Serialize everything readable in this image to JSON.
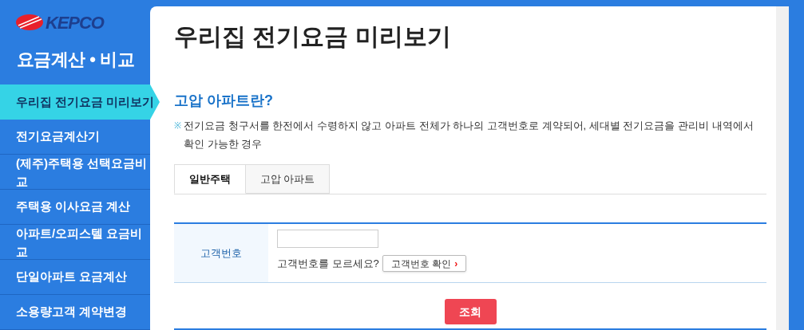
{
  "logo": {
    "text": "KEPCO"
  },
  "sidebar": {
    "title": "요금계산 • 비교",
    "items": [
      {
        "label": "우리집 전기요금 미리보기",
        "selected": true
      },
      {
        "label": "전기요금계산기",
        "selected": false
      },
      {
        "label": "(제주)주택용 선택요금비교",
        "selected": false
      },
      {
        "label": "주택용 이사요금 계산",
        "selected": false
      },
      {
        "label": "아파트/오피스텔 요금비교",
        "selected": false
      },
      {
        "label": "단일아파트 요금계산",
        "selected": false
      },
      {
        "label": "소용량고객 계약변경",
        "selected": false
      }
    ]
  },
  "page": {
    "title": "우리집 전기요금 미리보기",
    "section_title": "고압 아파트란?",
    "bullet": "※",
    "description": "전기요금 청구서를 한전에서 수령하지 않고 아파트 전체가 하나의 고객번호로 계약되어, 세대별 전기요금을 관리비 내역에서 확인 가능한 경우"
  },
  "tabs": [
    {
      "label": "일반주택",
      "selected": true
    },
    {
      "label": "고압 아파트",
      "selected": false
    }
  ],
  "form": {
    "label": "고객번호",
    "hint": "고객번호를 모르세요?",
    "lookup_button": "고객번호 확인",
    "lookup_arrow": "›",
    "submit": "조회"
  }
}
